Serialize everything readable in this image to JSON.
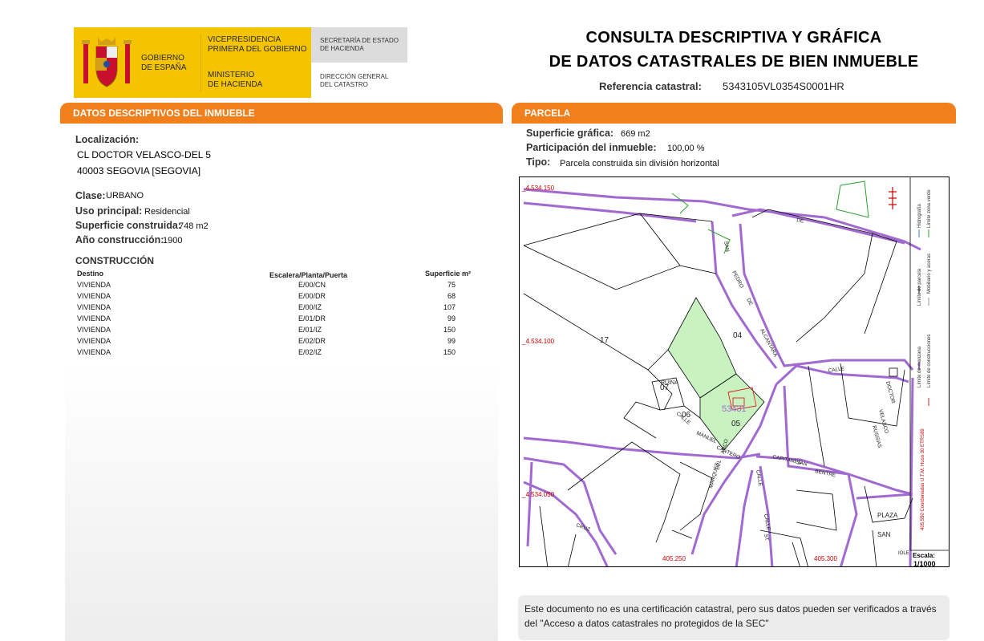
{
  "header": {
    "gobierno": [
      "GOBIERNO",
      "DE ESPAÑA"
    ],
    "vicepresidencia": [
      "VICEPRESIDENCIA",
      "PRIMERA DEL GOBIERNO"
    ],
    "ministerio": [
      "MINISTERIO",
      "DE HACIENDA"
    ],
    "secretaria": [
      "SECRETARÍA DE ESTADO",
      "DE HACIENDA"
    ],
    "direccion": [
      "DIRECCIÓN GENERAL",
      "DEL CATASTRO"
    ],
    "title_line1": "CONSULTA DESCRIPTIVA Y GRÁFICA",
    "title_line2": "DE DATOS CATASTRALES DE BIEN INMUEBLE",
    "ref_label": "Referencia catastral:",
    "ref_value": "5343105VL0354S0001HR"
  },
  "left": {
    "section_title": "DATOS DESCRIPTIVOS DEL INMUEBLE",
    "localizacion_label": "Localización:",
    "address_line1": "CL DOCTOR VELASCO-DEL 5",
    "address_line2": "40003 SEGOVIA [SEGOVIA]",
    "clase_label": "Clase:",
    "clase_value": "URBANO",
    "uso_label": "Uso principal:",
    "uso_value": "Residencial",
    "superficie_label": "Superficie construida:",
    "superficie_value": "748 m2",
    "anio_label": "Año construcción:",
    "anio_value": "1900",
    "construccion_title": "CONSTRUCCIÓN",
    "table_headers": [
      "Destino",
      "Escalera/Planta/Puerta",
      "Superficie m²"
    ],
    "table_rows": [
      [
        "VIVIENDA",
        "E/00/CN",
        "75"
      ],
      [
        "VIVIENDA",
        "E/00/DR",
        "68"
      ],
      [
        "VIVIENDA",
        "E/00/IZ",
        "107"
      ],
      [
        "VIVIENDA",
        "E/01/DR",
        "99"
      ],
      [
        "VIVIENDA",
        "E/01/IZ",
        "150"
      ],
      [
        "VIVIENDA",
        "E/02/DR",
        "99"
      ],
      [
        "VIVIENDA",
        "E/02/IZ",
        "150"
      ]
    ]
  },
  "right": {
    "section_title": "PARCELA",
    "sup_grafica_label": "Superficie gráfica:",
    "sup_grafica_value": "669 m2",
    "participacion_label": "Participación del inmueble:",
    "participacion_value": "100,00 %",
    "tipo_label": "Tipo:",
    "tipo_value": "Parcela construida sin división horizontal",
    "map": {
      "coord_labels": [
        "_4.534.150",
        "_4.534.100",
        "_4.534.050",
        "405.250",
        "405.300"
      ],
      "parcel_numbers": [
        "17",
        "04",
        "05",
        "06",
        "07"
      ],
      "parcel_id": "53431",
      "ruina": "RUINA",
      "plaza": [
        "PLAZA",
        "SAN"
      ],
      "iole": "IOLE",
      "street_labels": [
        "DE",
        "SAN",
        "PEDRO",
        "DE",
        "ALCANTARA",
        "CALLE",
        "DOCTOR",
        "VELASCO",
        "MARQUES",
        "DEL",
        "ARCO",
        "CALLE",
        "MANUEL",
        "CANTERO",
        "CRUZ",
        "CALLE",
        "CAPITANES",
        "SAN",
        "BENTRE",
        "CALLE",
        "ST",
        "RUSSIAS"
      ],
      "legend": [
        "Límite de manzana",
        "Límite de parcela",
        "Límite de construcciones",
        "Mobiliario y aceras",
        "Límite zona verde",
        "Hidrografía"
      ],
      "coord_note": "405,550 Coordenadas U.T.M. Huso 30 ETRS89",
      "scale_label": "Escala:",
      "scale_value": "1/1000",
      "colors": {
        "manzana": "#a06ad0",
        "parcela": "#000000",
        "construcciones": "#e02020",
        "verde": "#2aa02a",
        "verde_fill": "#c8f2c0"
      }
    },
    "disclaimer": "Este documento no es una certificación catastral, pero sus datos pueden ser verificados a través del \"Acceso a datos catastrales no protegidos de la SEC\""
  }
}
